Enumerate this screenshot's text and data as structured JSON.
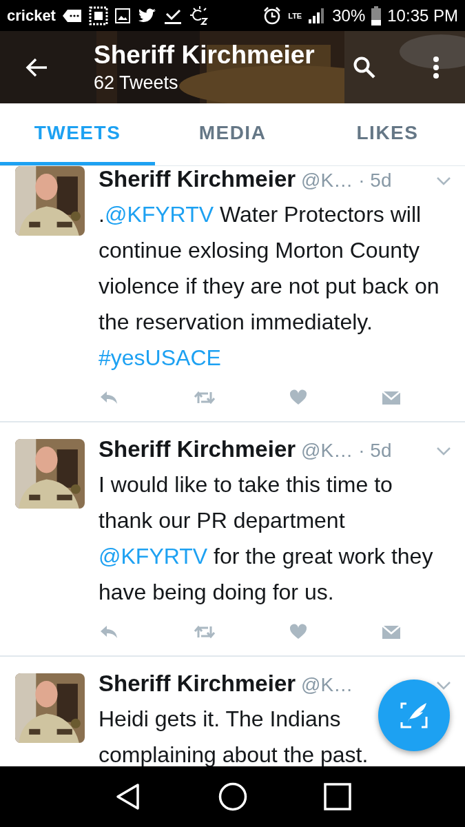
{
  "status_bar": {
    "carrier": "cricket",
    "network": "LTE",
    "battery": "30%",
    "time": "10:35 PM"
  },
  "header": {
    "title": "Sheriff Kirchmeier",
    "subtitle": "62 Tweets"
  },
  "tabs": [
    {
      "label": "TWEETS",
      "selected": true
    },
    {
      "label": "MEDIA",
      "selected": false
    },
    {
      "label": "LIKES",
      "selected": false
    }
  ],
  "tweets": [
    {
      "name": "Sheriff Kirchmeier",
      "handle": "@K…",
      "time": "· 5d",
      "text": [
        {
          "kind": "plain",
          "text": "."
        },
        {
          "kind": "link",
          "text": "@KFYRTV"
        },
        {
          "kind": "plain",
          "text": " Water Protectors will continue exlosing Morton County violence if they are not put back on the reservation immediately. "
        },
        {
          "kind": "link",
          "text": "#yesUSACE"
        }
      ]
    },
    {
      "name": "Sheriff Kirchmeier",
      "handle": "@K…",
      "time": "· 5d",
      "text": [
        {
          "kind": "plain",
          "text": "I would like to take this time to thank our PR department "
        },
        {
          "kind": "link",
          "text": "@KFYRTV"
        },
        {
          "kind": "plain",
          "text": " for the great work they have being doing for us."
        }
      ]
    },
    {
      "name": "Sheriff Kirchmeier",
      "handle": "@K…",
      "text": [
        {
          "kind": "plain",
          "text": "Heidi gets it. The Indians complaining about the past."
        }
      ]
    }
  ]
}
